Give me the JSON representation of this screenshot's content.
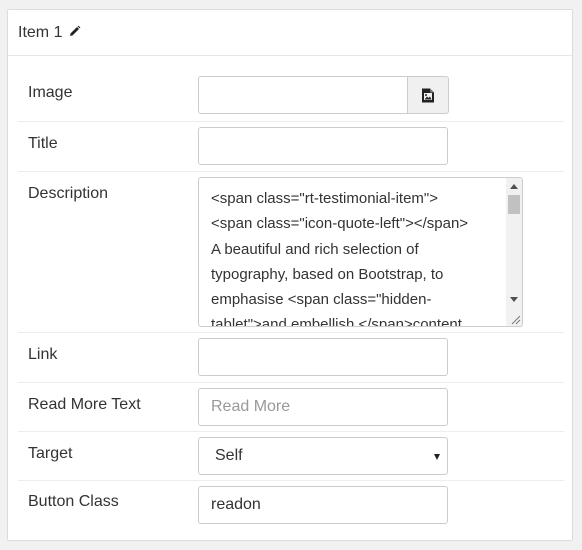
{
  "item": {
    "title": "Item 1",
    "edit_icon": "pencil-icon"
  },
  "fields": {
    "image": {
      "label": "Image",
      "value": "",
      "button_icon": "image-file-icon"
    },
    "title": {
      "label": "Title",
      "value": ""
    },
    "description": {
      "label": "Description",
      "value": "<span class=\"rt-testimonial-item\">\n<span class=\"icon-quote-left\"></span>\nA beautiful and rich selection of\ntypography, based on Bootstrap, to\nemphasise <span class=\"hidden-\ntablet\">and embellish </span>content"
    },
    "link": {
      "label": "Link",
      "value": ""
    },
    "read_more": {
      "label": "Read More Text",
      "placeholder": "Read More",
      "value": ""
    },
    "target": {
      "label": "Target",
      "selected": "Self"
    },
    "button_class": {
      "label": "Button Class",
      "value": "readon"
    }
  }
}
